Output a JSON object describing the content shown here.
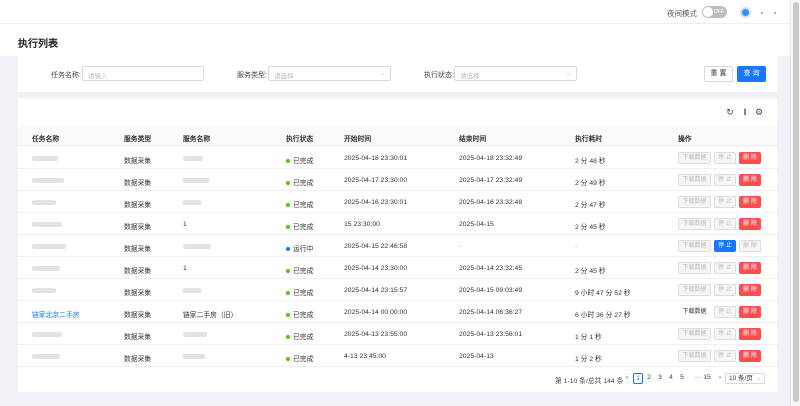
{
  "topbar": {
    "night_mode_label": "夜间模式",
    "toggle_text": "OFF"
  },
  "page": {
    "title": "执行列表"
  },
  "filters": {
    "task_name_label": "任务名称:",
    "task_name_placeholder": "请输入",
    "service_type_label": "服务类型:",
    "service_type_placeholder": "请选择",
    "exec_status_label": "执行状态:",
    "exec_status_placeholder": "请选择",
    "reset_label": "重 置",
    "query_label": "查 询"
  },
  "table": {
    "columns": [
      "任务名称",
      "服务类型",
      "服务名称",
      "执行状态",
      "开始时间",
      "结束时间",
      "执行耗时",
      "操作"
    ],
    "actions": {
      "download": "下载数据",
      "stop": "停 止",
      "delete": "删 除"
    },
    "rows": [
      {
        "task": "",
        "type": "数据采集",
        "service": "",
        "status": "已完成",
        "status_color": "#52c41a",
        "start": "2025-04-18 23:30:01",
        "end": "2025-04-18 23:32:49",
        "duration": "2 分 48 秒",
        "ops": "done"
      },
      {
        "task": "",
        "type": "数据采集",
        "service": "",
        "status": "已完成",
        "status_color": "#52c41a",
        "start": "2025-04-17 23:30:00",
        "end": "2025-04-17 23:32:49",
        "duration": "2 分 49 秒",
        "ops": "done"
      },
      {
        "task": "",
        "type": "数据采集",
        "service": "",
        "status": "已完成",
        "status_color": "#52c41a",
        "start": "2025-04-16 23:30:01",
        "end": "2025-04-16 23:32:48",
        "duration": "2 分 47 秒",
        "ops": "done"
      },
      {
        "task": "",
        "type": "数据采集",
        "service": "1",
        "status": "已完成",
        "status_color": "#52c41a",
        "start": "15 23:30:00",
        "end": "2025-04-15",
        "duration": "2 分 45 秒",
        "ops": "done"
      },
      {
        "task": "",
        "type": "数据采集",
        "service": "",
        "status": "运行中",
        "status_color": "#1677ff",
        "start": "2025-04-15 22:46:58",
        "end": "-",
        "duration": "-",
        "ops": "running"
      },
      {
        "task": "",
        "type": "数据采集",
        "service": "1",
        "status": "已完成",
        "status_color": "#52c41a",
        "start": "2025-04-14 23:30:00",
        "end": "2025-04-14 23:32:45",
        "duration": "2 分 45 秒",
        "ops": "done"
      },
      {
        "task": "",
        "type": "数据采集",
        "service": "",
        "status": "已完成",
        "status_color": "#52c41a",
        "start": "2025-04-14 23:15:57",
        "end": "2025-04-15 09:03:49",
        "duration": "9 小时 47 分 52 秒",
        "ops": "done"
      },
      {
        "task": "链家北京二手房",
        "type": "数据采集",
        "service": "链家二手房（旧）",
        "status": "已完成",
        "status_color": "#52c41a",
        "start": "2025-04-14 00:00:00",
        "end": "2025-04-14 06:36:27",
        "duration": "6 小时 36 分 27 秒",
        "ops": "done_active"
      },
      {
        "task": "",
        "type": "数据采集",
        "service": "",
        "status": "已完成",
        "status_color": "#52c41a",
        "start": "2025-04-13 23:55:00",
        "end": "2025-04-13 23:56:01",
        "duration": "1 分 1 秒",
        "ops": "done"
      },
      {
        "task": "",
        "type": "数据采集",
        "service": "",
        "status": "已完成",
        "status_color": "#52c41a",
        "start": "4-13 23:45:00",
        "end": "2025-04-13",
        "duration": "1 分 2 秒",
        "ops": "done"
      }
    ]
  },
  "pagination": {
    "summary": "第 1-10 条/总共 144 条",
    "pages": [
      "1",
      "2",
      "3",
      "4",
      "5"
    ],
    "ellipsis": "···",
    "last_page": "15",
    "page_size": "10 条/页",
    "current": "1"
  }
}
